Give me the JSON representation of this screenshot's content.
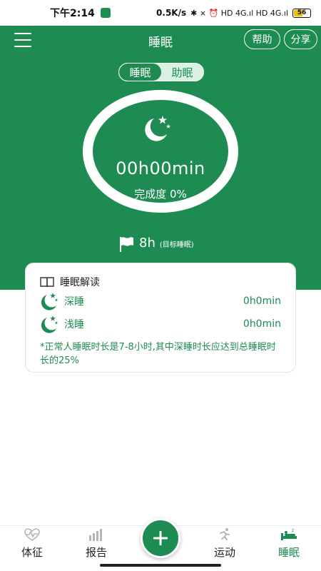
{
  "status_bar": {
    "time": "下午2:14",
    "net_speed": "0.5K/s",
    "glyphs": "✱ ⨯ ⏰ HD 4G.ıl HD 4G.ıl",
    "battery": "56",
    "battery_level_percent": 56
  },
  "header": {
    "title": "睡眠",
    "help_label": "帮助",
    "share_label": "分享"
  },
  "mode_toggle": {
    "options": [
      "睡眠",
      "助眠"
    ],
    "selected": "睡眠"
  },
  "summary": {
    "duration": "00h00min",
    "completion": "完成度 0%",
    "progress_percent": 0
  },
  "goal": {
    "value": "8h",
    "label": "(目标睡眠)"
  },
  "interpretation": {
    "title": "睡眠解读",
    "rows": [
      {
        "label": "深睡",
        "value": "0h0min"
      },
      {
        "label": "浅睡",
        "value": "0h0min"
      }
    ],
    "note": "*正常人睡眠时长是7-8小时,其中深睡时长应达到总睡眠时长的25%"
  },
  "bottom_nav": {
    "items": [
      {
        "label": "体征",
        "icon": "heartbeat-icon",
        "active": false
      },
      {
        "label": "报告",
        "icon": "bar-chart-icon",
        "active": false
      },
      {
        "label": "运动",
        "icon": "runner-icon",
        "active": false
      },
      {
        "label": "睡眠",
        "icon": "bed-icon",
        "active": true
      }
    ],
    "add_icon": "plus-icon"
  },
  "colors": {
    "brand_green": "#1e8c52",
    "toggle_bg": "#d9f2e3"
  }
}
